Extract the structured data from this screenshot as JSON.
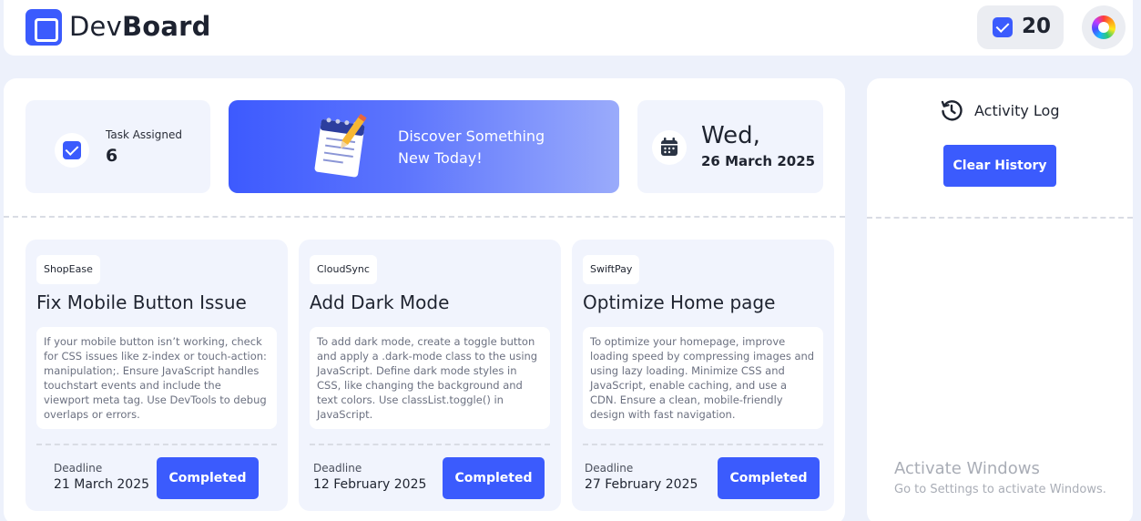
{
  "header": {
    "brand_light": "Dev",
    "brand_bold": "Board",
    "completed_count": "20"
  },
  "stats": {
    "task_label": "Task Assigned",
    "task_value": "6"
  },
  "promo": {
    "line1": "Discover Something",
    "line2": "New Today!"
  },
  "date": {
    "day": "Wed,",
    "full": "26 March 2025"
  },
  "tasks": [
    {
      "tag": "ShopEase",
      "title": "Fix Mobile Button Issue",
      "description": "If your mobile button isn’t working, check for CSS issues like z-index or touch-action: manipulation;. Ensure JavaScript handles touchstart events and include the viewport meta tag. Use DevTools to debug overlaps or errors.",
      "deadline_label": "Deadline",
      "deadline": "21 March 2025",
      "status": "Completed"
    },
    {
      "tag": "CloudSync",
      "title": "Add Dark Mode",
      "description": "To add dark mode, create a toggle button and apply a .dark-mode class to the using JavaScript. Define dark mode styles in CSS, like changing the background and text colors. Use classList.toggle() in JavaScript.",
      "deadline_label": "Deadline",
      "deadline": "12 February 2025",
      "status": "Completed"
    },
    {
      "tag": "SwiftPay",
      "title": "Optimize Home page",
      "description": "To optimize your homepage, improve loading speed by compressing images and using lazy loading. Minimize CSS and JavaScript, enable caching, and use a CDN. Ensure a clean, mobile-friendly design with fast navigation.",
      "deadline_label": "Deadline",
      "deadline": "27 February 2025",
      "status": "Completed"
    }
  ],
  "activity": {
    "title": "Activity Log",
    "clear_label": "Clear History"
  },
  "watermark": {
    "title": "Activate Windows",
    "subtitle": "Go to Settings to activate Windows."
  },
  "colors": {
    "accent": "#3b5bfd",
    "background": "#edf1fb",
    "card": "#f1f4fd"
  },
  "icons": {
    "logo": "devboard-logo-icon",
    "counter": "checkbox-icon",
    "avatar": "color-wheel-icon",
    "stat": "checkbox-icon",
    "promo": "notepad-pencil-icon",
    "date": "calendar-icon",
    "activity": "history-icon"
  }
}
